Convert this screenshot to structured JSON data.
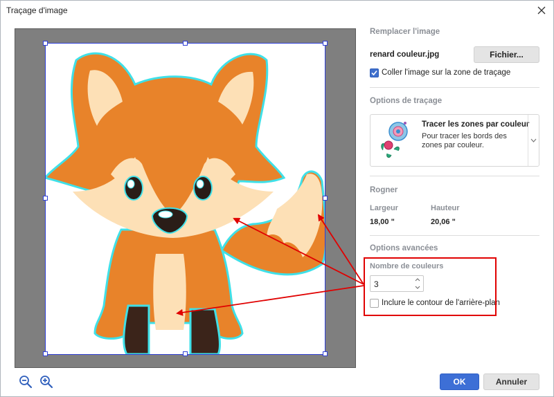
{
  "window": {
    "title": "Traçage d'image"
  },
  "replace": {
    "section_title": "Remplacer l'image",
    "filename": "renard couleur.jpg",
    "file_button": "Fichier...",
    "paste_checkbox_label": "Coller l'image sur la zone de traçage",
    "paste_checked": true
  },
  "trace": {
    "section_title": "Options de traçage",
    "mode_title": "Tracer les zones par couleur",
    "mode_desc": "Pour tracer les bords des zones par couleur."
  },
  "crop": {
    "section_title": "Rogner",
    "width_label": "Largeur",
    "height_label": "Hauteur",
    "width_value": "18,00 \"",
    "height_value": "20,06 \""
  },
  "advanced": {
    "section_title": "Options avancées",
    "colors_label": "Nombre de couleurs",
    "colors_value": "3",
    "bg_checkbox_label": "Inclure le contour de l'arrière-plan",
    "bg_checked": false
  },
  "buttons": {
    "ok": "OK",
    "cancel": "Annuler"
  },
  "colors": {
    "accent": "#3d6fd6",
    "annotation": "#e00000",
    "fox_orange": "#e8832a",
    "fox_cream": "#fde0b6",
    "outline": "#3fe0e8"
  },
  "icons": {
    "close": "close-icon",
    "zoom_out": "zoom-out-icon",
    "zoom_in": "zoom-in-icon",
    "mode": "flower-icon",
    "mode_expand": "chevron-down-icon"
  }
}
